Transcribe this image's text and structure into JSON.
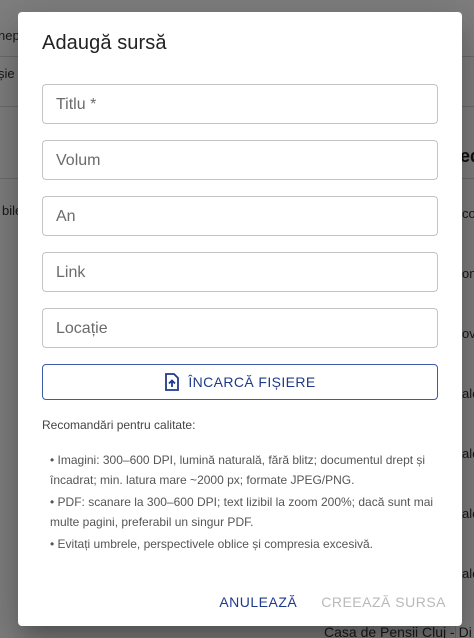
{
  "background": {
    "fragments": [
      "nep",
      "șie",
      "bile",
      "ed",
      "co",
      "on",
      "ov",
      "ale",
      "ale",
      "ale",
      "ale",
      "ale"
    ],
    "bottom_row": "Casa de Pensii Cluj - Di"
  },
  "dialog": {
    "title": "Adaugă sursă",
    "fields": [
      {
        "label": "Titlu",
        "required_mark": " *"
      },
      {
        "label": "Volum"
      },
      {
        "label": "An"
      },
      {
        "label": "Link"
      },
      {
        "label": "Locație"
      }
    ],
    "upload": {
      "label": "ÎNCARCĂ FIȘIERE",
      "icon": "file-upload-icon"
    },
    "recommendations": {
      "title": "Recomandări pentru calitate:",
      "items": [
        "• Imagini: 300–600 DPI, lumină naturală, fără blitz; documentul drept și încadrat; min. latura mare ~2000 px; formate JPEG/PNG.",
        "• PDF: scanare la 300–600 DPI; text lizibil la zoom 200%; dacă sunt mai multe pagini, preferabil un singur PDF.",
        "• Evitați umbrele, perspectivele oblice și compresia excesivă."
      ]
    },
    "actions": {
      "cancel": "ANULEAZĂ",
      "create": "CREEAZĂ SURSA"
    }
  },
  "colors": {
    "accent": "#1f3a8a",
    "disabled": "#b9b9b9",
    "overlay": "rgba(0,0,0,0.5)"
  }
}
